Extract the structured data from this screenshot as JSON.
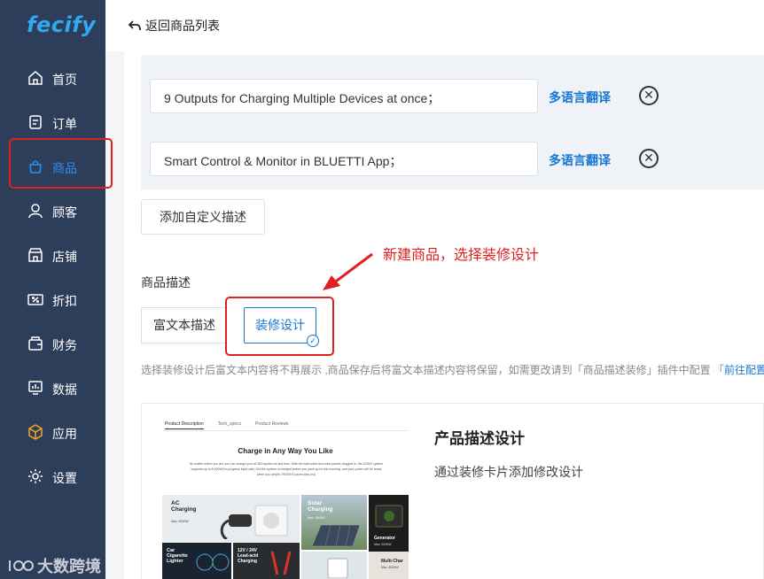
{
  "app": {
    "logo": "fecify"
  },
  "sidebar": {
    "items": [
      {
        "label": "首页",
        "icon": "home-icon"
      },
      {
        "label": "订单",
        "icon": "order-icon"
      },
      {
        "label": "商品",
        "icon": "bag-icon",
        "active": true
      },
      {
        "label": "顾客",
        "icon": "user-icon"
      },
      {
        "label": "店铺",
        "icon": "store-icon"
      },
      {
        "label": "折扣",
        "icon": "discount-icon"
      },
      {
        "label": "财务",
        "icon": "wallet-icon"
      },
      {
        "label": "数据",
        "icon": "chart-icon"
      },
      {
        "label": "应用",
        "icon": "app-box-icon"
      },
      {
        "label": "设置",
        "icon": "gear-icon"
      }
    ],
    "watermark": "大数跨境"
  },
  "header": {
    "back_label": "返回商品列表"
  },
  "descriptions": {
    "fields": [
      {
        "value": "9 Outputs for Charging Multiple Devices at once；",
        "translate_label": "多语言翻译"
      },
      {
        "value": "Smart Control & Monitor in BLUETTI App；",
        "translate_label": "多语言翻译"
      }
    ],
    "add_custom_label": "添加自定义描述"
  },
  "annotation": "新建商品，选择装修设计",
  "product_description": {
    "section_label": "商品描述",
    "tabs": [
      {
        "label": "富文本描述",
        "selected": false
      },
      {
        "label": "装修设计",
        "selected": true
      }
    ],
    "hint_text": "选择装修设计后富文本内容将不再展示 ,商品保存后将富文本描述内容将保留，如需更改请到「商品描述装修」插件中配置 「",
    "hint_link": "前往配置"
  },
  "design_card": {
    "title": "产品描述设计",
    "description": "通过装修卡片添加修改设计",
    "preview": {
      "tabs": [
        "Product Description",
        "Tech_specs",
        "Product Reviews"
      ],
      "heading": "Charge in Any Way You Like",
      "body": "No matter where you are you can charge your AC500 system at any time. With the wall outlet and solar panels plugged in, the AC500 system supports up to 8,000W(*in-progress input rate) Get the system recharged before you pack up for the morning, and your power will be ready when you are(it's 3*B300 it paces step-ins)",
      "tiles": [
        {
          "title": "AC\nCharging",
          "sub": "Max. 5000W"
        },
        {
          "title": "Solar\nCharging",
          "sub": "Max. 3000W"
        },
        {
          "title": "Generator",
          "sub": "Max. 5000W"
        },
        {
          "title": "Car\nCigarette\nLighter",
          "sub": ""
        },
        {
          "title": "12V / 24V\nLead-acid\nCharging",
          "sub": ""
        },
        {
          "title": "Multi-Char",
          "sub": "Max. 8000W"
        }
      ]
    }
  },
  "colors": {
    "sidebar_bg": "#2c3e5a",
    "accent": "#1677d2",
    "highlight": "#e02020"
  }
}
